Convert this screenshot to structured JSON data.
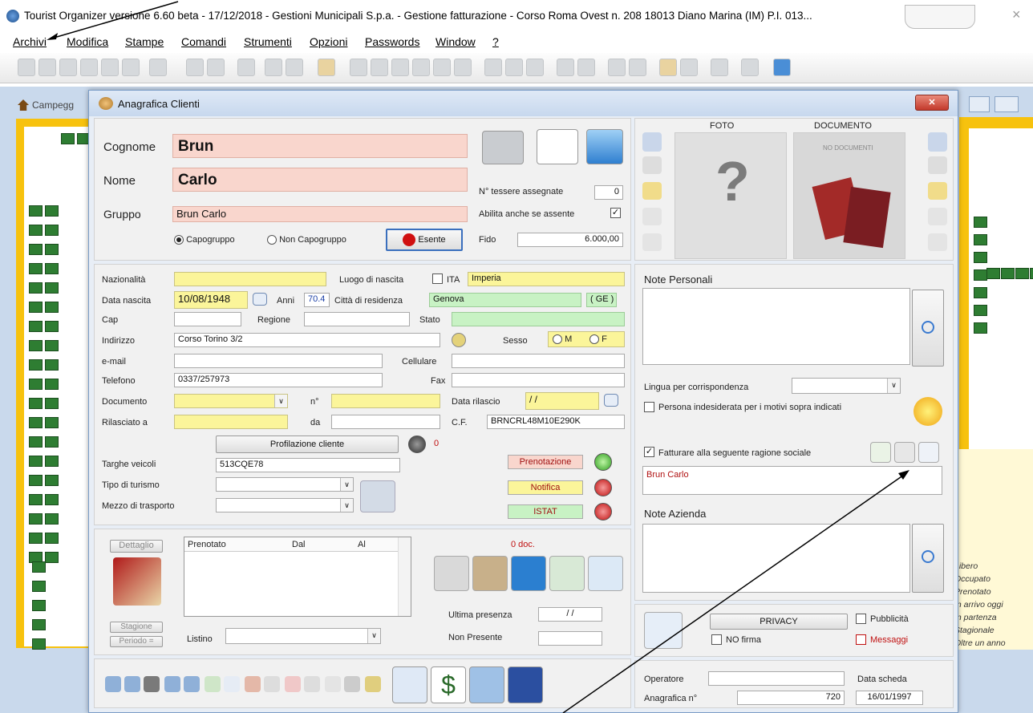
{
  "app": {
    "title": "Tourist Organizer versione 6.60 beta - 17/12/2018 - Gestioni Municipali S.p.a. - Gestione fatturazione - Corso Roma Ovest n. 208 18013 Diano Marina (IM) P.I. 013..."
  },
  "menu": [
    "Archivi",
    "Modifica",
    "Stampe",
    "Comandi",
    "Strumenti",
    "Opzioni",
    "Passwords",
    "Window",
    "?"
  ],
  "background": {
    "window_title": "Campegg",
    "legend": [
      "Libero",
      "Occupato",
      "Prenotato",
      "In arrivo oggi",
      "In partenza",
      "Stagionale",
      "Oltre un anno"
    ]
  },
  "dialog": {
    "title": "Anagrafica Clienti",
    "close_symbol": "✕",
    "cognome_label": "Cognome",
    "cognome": "Brun",
    "nome_label": "Nome",
    "nome": "Carlo",
    "gruppo_label": "Gruppo",
    "gruppo": "Brun Carlo",
    "capogruppo": "Capogruppo",
    "non_capogruppo": "Non Capogruppo",
    "esente": "Esente",
    "tessere_label": "N° tessere assegnate",
    "tessere": "0",
    "abilita_label": "Abilita anche se assente",
    "fido_label": "Fido",
    "fido": "6.000,00",
    "foto_label": "FOTO",
    "documento_label": "DOCUMENTO",
    "no_documenti": "NO DOCUMENTI",
    "nazionalita_label": "Nazionalità",
    "luogo_nascita_label": "Luogo di nascita",
    "ita_label": "ITA",
    "luogo_nascita": "Imperia",
    "data_nascita_label": "Data nascita",
    "data_nascita": "10/08/1948",
    "anni_label": "Anni",
    "anni": "70.4",
    "citta_label": "Città di residenza",
    "citta": "Genova",
    "provincia": "( GE )",
    "cap_label": "Cap",
    "regione_label": "Regione",
    "stato_label": "Stato",
    "indirizzo_label": "Indirizzo",
    "indirizzo": "Corso Torino 3/2",
    "sesso_label": "Sesso",
    "sesso_m": "M",
    "sesso_f": "F",
    "email_label": "e-mail",
    "cellulare_label": "Cellulare",
    "telefono_label": "Telefono",
    "telefono": "0337/257973",
    "fax_label": "Fax",
    "documento_field_label": "Documento",
    "n_label": "n°",
    "data_rilascio_label": "Data rilascio",
    "data_rilascio": "/ /",
    "rilasciato_label": "Rilasciato a",
    "da_label": "da",
    "cf_label": "C.F.",
    "cf": "BRNCRL48M10E290K",
    "profilazione": "Profilazione cliente",
    "profilazione_count": "0",
    "targhe_label": "Targhe veicoli",
    "targhe": "513CQE78",
    "tipo_turismo_label": "Tipo di turismo",
    "mezzo_label": "Mezzo di trasporto",
    "prenotazione": "Prenotazione",
    "notifica": "Notifica",
    "istat": "ISTAT",
    "note_personali_label": "Note Personali",
    "lingua_label": "Lingua per corrispondenza",
    "indesiderata_label": "Persona indesiderata per i motivi sopra indicati",
    "fatturare_label": "Fatturare alla seguente ragione sociale",
    "ragione_sociale": "Brun Carlo",
    "note_azienda_label": "Note Azienda",
    "dettaglio": "Dettaglio",
    "stagione": "Stagione",
    "periodo": "Periodo =",
    "listino_label": "Listino",
    "col_prenotato": "Prenotato",
    "col_dal": "Dal",
    "col_al": "Al",
    "doc_count": "0 doc.",
    "ultima_presenza_label": "Ultima presenza",
    "ultima_presenza": "/ /",
    "non_presente_label": "Non Presente",
    "privacy": "PRIVACY",
    "no_firma": "NO firma",
    "pubblicita": "Pubblicità",
    "messaggi": "Messaggi",
    "operatore_label": "Operatore",
    "data_scheda_label": "Data scheda",
    "anagrafica_label": "Anagrafica n°",
    "anagrafica_n": "720",
    "data_scheda": "16/01/1997"
  },
  "colors": {
    "pink": "#f9d6cd",
    "yellow": "#fbf59a",
    "green": "#c8f2c4",
    "accent": "#4a8ed6"
  }
}
